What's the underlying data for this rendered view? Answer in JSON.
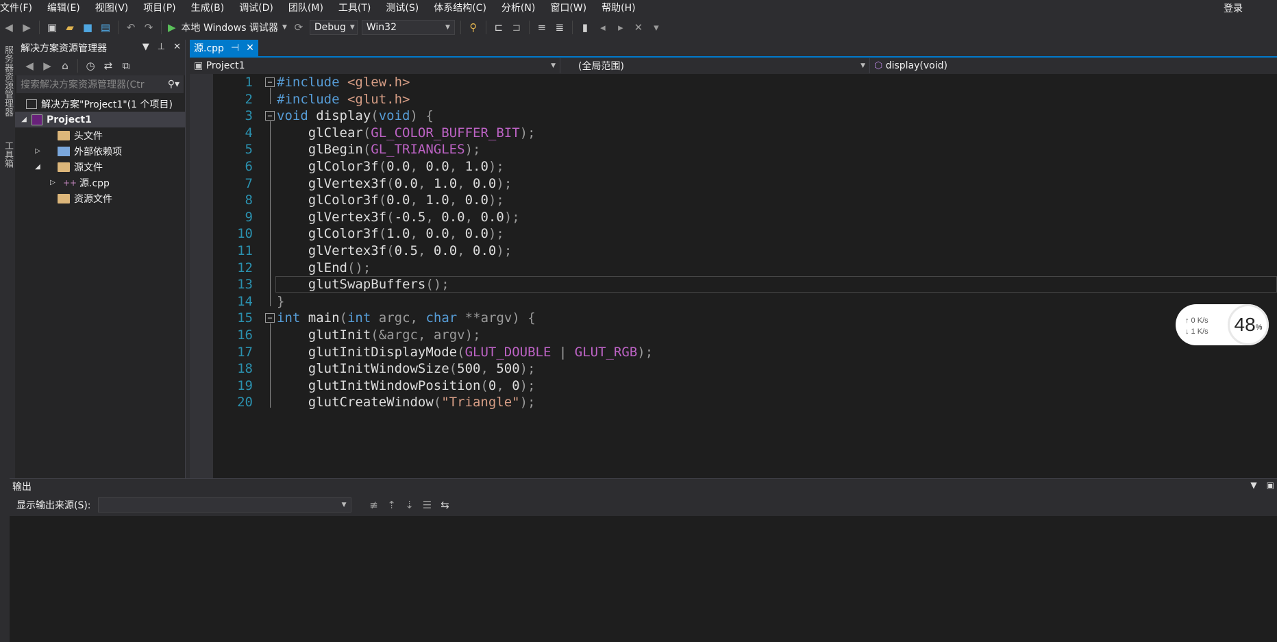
{
  "menubar": {
    "items": [
      "文件(F)",
      "编辑(E)",
      "视图(V)",
      "项目(P)",
      "生成(B)",
      "调试(D)",
      "团队(M)",
      "工具(T)",
      "测试(S)",
      "体系结构(C)",
      "分析(N)",
      "窗口(W)",
      "帮助(H)"
    ],
    "login": "登录"
  },
  "toolbar": {
    "run_label": "本地 Windows 调试器",
    "config": "Debug",
    "platform": "Win32"
  },
  "left_strip": {
    "label1": "服务器资源管理器",
    "label2": "工具箱"
  },
  "solution_explorer": {
    "title": "解决方案资源管理器",
    "search_placeholder": "搜索解决方案资源管理器(Ctr",
    "items": [
      {
        "label": "解决方案\"Project1\"(1 个项目)"
      },
      {
        "label": "Project1"
      },
      {
        "label": "头文件"
      },
      {
        "label": "外部依赖项"
      },
      {
        "label": "源文件"
      },
      {
        "label": "源.cpp"
      },
      {
        "label": "资源文件"
      }
    ]
  },
  "editor": {
    "tab": "源.cpp",
    "nav": {
      "project": "Project1",
      "scope": "(全局范围)",
      "member": "display(void)"
    },
    "line_numbers": [
      "1",
      "2",
      "3",
      "4",
      "5",
      "6",
      "7",
      "8",
      "9",
      "10",
      "11",
      "12",
      "13",
      "14",
      "15",
      "16",
      "17",
      "18",
      "19",
      "20"
    ],
    "lines": [
      "#include <glew.h>",
      "#include <glut.h>",
      "void display(void) {",
      "    glClear(GL_COLOR_BUFFER_BIT);",
      "    glBegin(GL_TRIANGLES);",
      "    glColor3f(0.0, 0.0, 1.0);",
      "    glVertex3f(0.0, 1.0, 0.0);",
      "    glColor3f(0.0, 1.0, 0.0);",
      "    glVertex3f(-0.5, 0.0, 0.0);",
      "    glColor3f(1.0, 0.0, 0.0);",
      "    glVertex3f(0.5, 0.0, 0.0);",
      "    glEnd();",
      "    glutSwapBuffers();",
      "}",
      "int main(int argc, char **argv) {",
      "    glutInit(&argc, argv);",
      "    glutInitDisplayMode(GLUT_DOUBLE | GLUT_RGB);",
      "    glutInitWindowSize(500, 500);",
      "    glutInitWindowPosition(0, 0);",
      "    glutCreateWindow(\"Triangle\");"
    ]
  },
  "netspeed": {
    "up": "↑ 0  K/s",
    "down": "↓ 1  K/s",
    "percent": "48",
    "percent_sign": "%"
  },
  "output": {
    "title": "输出",
    "source_label": "显示输出来源(S):"
  },
  "colors": {
    "accent": "#007acc",
    "bg": "#1e1e1e",
    "keyword": "#569cd6",
    "macro": "#bd63c5"
  }
}
